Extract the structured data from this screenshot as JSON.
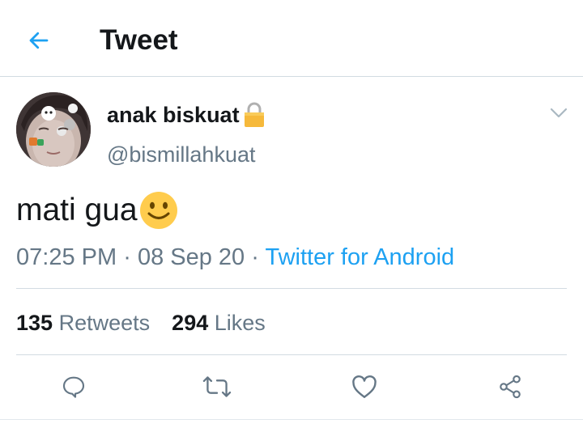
{
  "header": {
    "back_icon": "arrow-left-icon",
    "title": "Tweet",
    "accent_color": "#1da1f2"
  },
  "author": {
    "display_name": "anak biskuat",
    "handle": "@bismillahkuat",
    "protected_icon": "lock-icon",
    "menu_icon": "chevron-down-icon"
  },
  "tweet": {
    "text": "mati gua",
    "emoji_icon": "slightly-smiling-face-icon",
    "time": "07:25 PM",
    "date": "08 Sep 20",
    "separator": "·",
    "source": "Twitter for Android"
  },
  "stats": {
    "retweets_count": "135",
    "retweets_label": "Retweets",
    "likes_count": "294",
    "likes_label": "Likes"
  },
  "actions": [
    {
      "icon": "reply-icon"
    },
    {
      "icon": "retweet-icon"
    },
    {
      "icon": "like-icon"
    },
    {
      "icon": "share-icon"
    }
  ]
}
